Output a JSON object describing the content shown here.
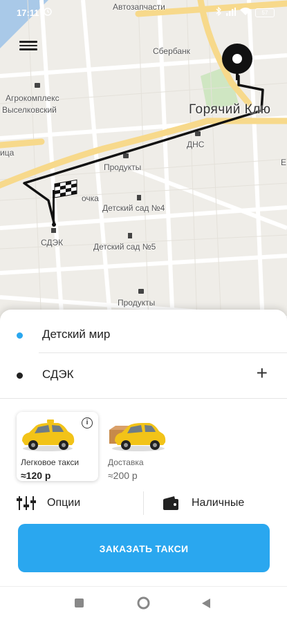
{
  "status_bar": {
    "time": "17:11",
    "carrier_label": "Автозапчасти",
    "battery": "57"
  },
  "map": {
    "labels": {
      "sberbank": "Сбербанк",
      "agrocomplex_1": "Агрокомплекс",
      "agrocomplex_2": "Выселковский",
      "city": "Горячий Клю",
      "dns": "ДНС",
      "products_1": "Продукты",
      "products_2": "Продукты",
      "kindergarten_4": "Детский сад №4",
      "kindergarten_5": "Детский сад №5",
      "sdek": "СДЭК",
      "pharmacy": "очка",
      "street": "ица",
      "edge_e": "Е"
    }
  },
  "route": {
    "from": "Детский мир",
    "to": "СДЭК"
  },
  "tariffs": [
    {
      "name": "Легковое такси",
      "price": "≈120 р",
      "selected": true
    },
    {
      "name": "Доставка",
      "price": "≈200 р",
      "selected": false
    }
  ],
  "options": {
    "options_label": "Опции",
    "payment_label": "Наличные"
  },
  "order_button": "ЗАКАЗАТЬ ТАКСИ",
  "colors": {
    "accent": "#2aa7ef",
    "origin_dot": "#2aa7ef",
    "destination_dot": "#222222",
    "taxi_yellow": "#f2c318"
  }
}
